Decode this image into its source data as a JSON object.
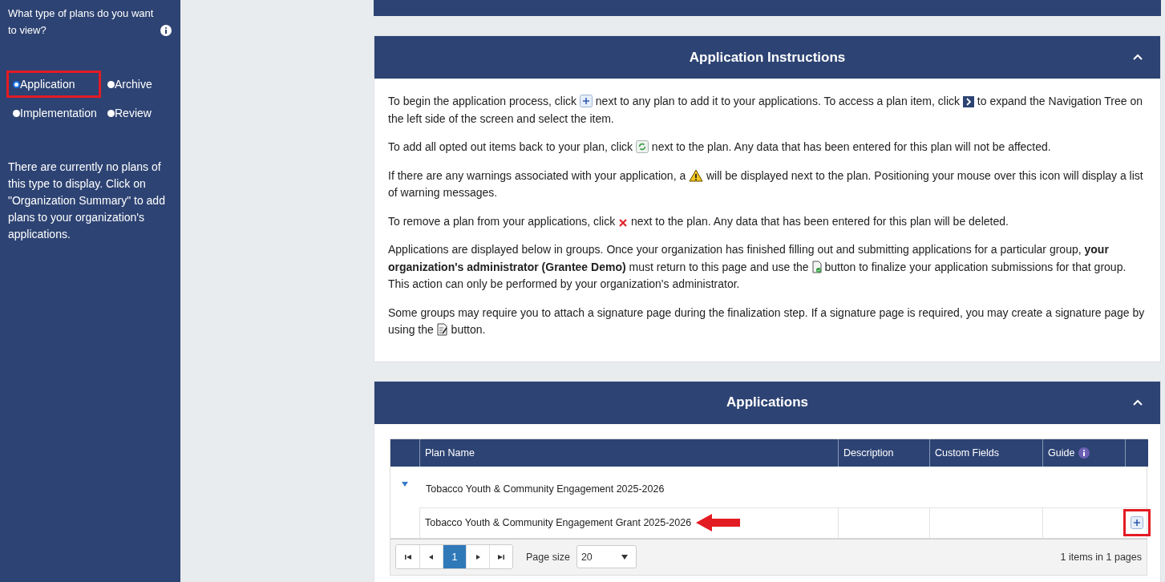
{
  "sidebar": {
    "question": "What type of plans do you want to view?",
    "options": [
      {
        "label": "Application",
        "selected": true,
        "highlighted": true
      },
      {
        "label": "Archive",
        "selected": false,
        "highlighted": false
      },
      {
        "label": "Implementation",
        "selected": false,
        "highlighted": false
      },
      {
        "label": "Review",
        "selected": false,
        "highlighted": false
      }
    ],
    "message": "There are currently no plans of this type to display. Click on \"Organization Summary\" to add plans to your organization's applications."
  },
  "instructions": {
    "title": "Application Instructions",
    "expanded": true,
    "paragraphs": [
      [
        {
          "kind": "text",
          "text": "To begin the application process, click "
        },
        {
          "kind": "add"
        },
        {
          "kind": "text",
          "text": " next to any plan to add it to your applications. To access a plan item, click "
        },
        {
          "kind": "expand"
        },
        {
          "kind": "text",
          "text": " to expand the Navigation Tree on the left side of the screen and select the item."
        }
      ],
      [
        {
          "kind": "text",
          "text": "To add all opted out items back to your plan, click "
        },
        {
          "kind": "restore"
        },
        {
          "kind": "text",
          "text": " next to the plan. Any data that has been entered for this plan will not be affected."
        }
      ],
      [
        {
          "kind": "text",
          "text": "If there are any warnings associated with your application, a "
        },
        {
          "kind": "warning"
        },
        {
          "kind": "text",
          "text": " will be displayed next to the plan. Positioning your mouse over this icon will display a list of warning messages."
        }
      ],
      [
        {
          "kind": "text",
          "text": "To remove a plan from your applications, click "
        },
        {
          "kind": "remove"
        },
        {
          "kind": "text",
          "text": " next to the plan. Any data that has been entered for this plan will be deleted."
        }
      ],
      [
        {
          "kind": "text",
          "text": "Applications are displayed below in groups. Once your organization has finished filling out and submitting applications for a particular group, **your organization's administrator (Grantee Demo)** must return to this page and use the "
        },
        {
          "kind": "finalize"
        },
        {
          "kind": "text",
          "text": " button to finalize your application submissions for that group. This action can only be performed by your organization's administrator."
        }
      ],
      [
        {
          "kind": "text",
          "text": "Some groups may require you to attach a signature page during the finalization step. If a signature page is required, you may create a signature page by using the "
        },
        {
          "kind": "signature"
        },
        {
          "kind": "text",
          "text": " button."
        }
      ]
    ]
  },
  "applications": {
    "title": "Applications",
    "expanded": true,
    "table": {
      "columns": [
        "Plan Name",
        "Description",
        "Custom Fields",
        "Guide"
      ],
      "groups": [
        {
          "name": "Tobacco Youth & Community Engagement 2025-2026",
          "expanded": true,
          "rows": [
            {
              "plan_name": "Tobacco Youth & Community Engagement Grant 2025-2026",
              "pointer_arrow": true,
              "add_highlighted": true
            }
          ]
        }
      ]
    },
    "pager": {
      "pages": [
        {
          "label": "1",
          "selected": true
        }
      ],
      "page_size_label": "Page size",
      "page_size": "20",
      "summary": "1 items in 1 pages"
    }
  }
}
